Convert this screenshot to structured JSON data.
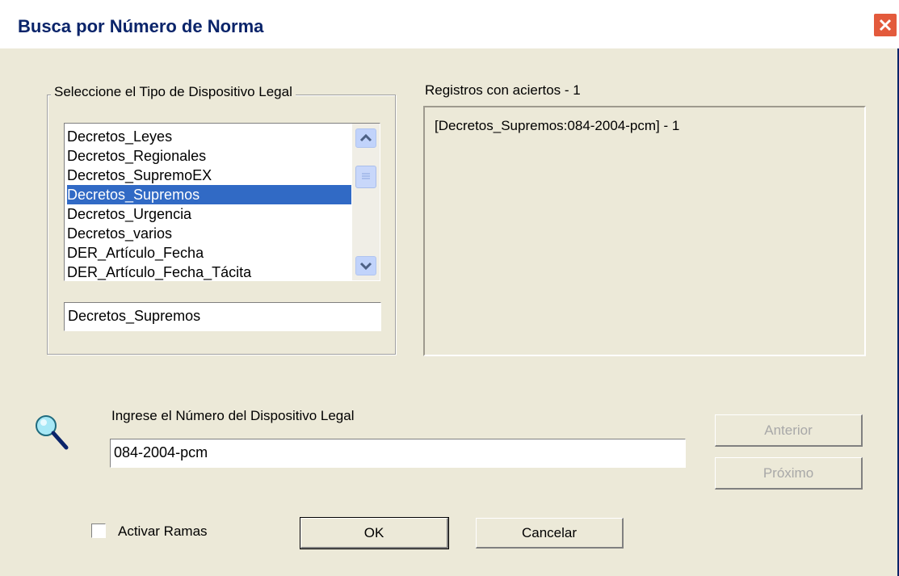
{
  "window": {
    "title": "Busca por Número de Norma",
    "close_icon": "close-icon"
  },
  "device_type_group": {
    "label": "Seleccione el Tipo de Dispositivo Legal",
    "items": [
      "Decretos_Leyes",
      "Decretos_Regionales",
      "Decretos_SupremoEX",
      "Decretos_Supremos",
      "Decretos_Urgencia",
      "Decretos_varios",
      "DER_Artículo_Fecha",
      "DER_Artículo_Fecha_Tácita"
    ],
    "selected_index": 3,
    "selected_value": "Decretos_Supremos"
  },
  "records": {
    "label": "Registros con aciertos - 1",
    "items": [
      "[Decretos_Supremos:084-2004-pcm] - 1"
    ]
  },
  "number_field": {
    "label": "Ingrese el Número del Dispositivo Legal",
    "value": "084-2004-pcm",
    "icon": "magnifier-icon"
  },
  "buttons": {
    "previous": "Anterior",
    "next": "Próximo",
    "ok": "OK",
    "cancel": "Cancelar"
  },
  "activate_branches": {
    "label": "Activar Ramas",
    "checked": false
  },
  "colors": {
    "title_text": "#0A246A",
    "selection": "#316AC5",
    "dialog_bg": "#ECE9D8",
    "close_button": "#E35A3C"
  }
}
